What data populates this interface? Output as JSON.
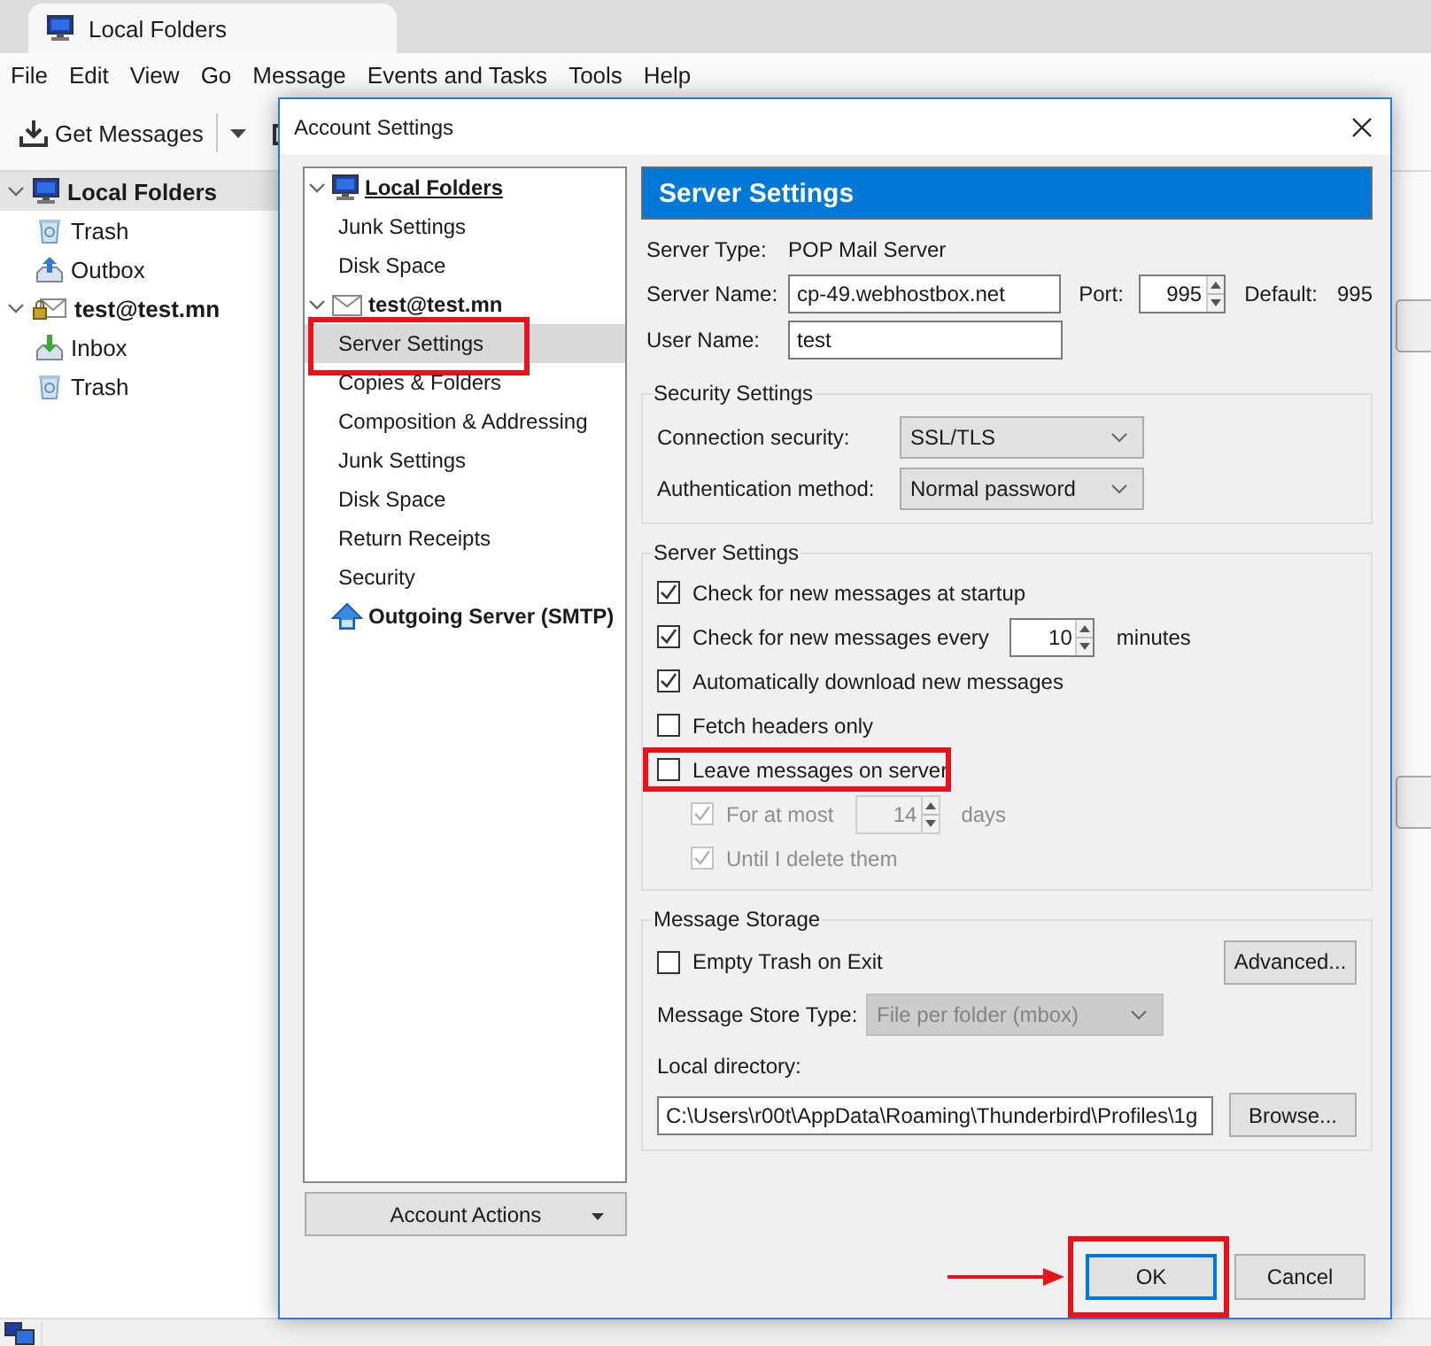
{
  "app_tab": {
    "title": "Local Folders"
  },
  "menu": [
    "File",
    "Edit",
    "View",
    "Go",
    "Message",
    "Events and Tasks",
    "Tools",
    "Help"
  ],
  "toolbar": {
    "get_messages": "Get Messages"
  },
  "folders": [
    {
      "label": "Local Folders",
      "kind": "computer",
      "expanded": true,
      "selected": true,
      "children": [
        {
          "label": "Trash",
          "kind": "trash",
          "selected": false
        },
        {
          "label": "Outbox",
          "kind": "outbox",
          "selected": false
        }
      ]
    },
    {
      "label": "test@test.mn",
      "kind": "account",
      "expanded": true,
      "selected": false,
      "children": [
        {
          "label": "Inbox",
          "kind": "inbox",
          "selected": false
        },
        {
          "label": "Trash",
          "kind": "trash",
          "selected": false
        }
      ]
    }
  ],
  "dialog": {
    "title": "Account Settings",
    "tree": [
      {
        "label": "Local Folders",
        "kind": "computer",
        "expanded": true,
        "selected": false,
        "children": [
          {
            "label": "Junk Settings",
            "selected": false,
            "highlighted": false
          },
          {
            "label": "Disk Space",
            "selected": false,
            "highlighted": false
          }
        ]
      },
      {
        "label": "test@test.mn",
        "kind": "account",
        "expanded": true,
        "selected": false,
        "children": [
          {
            "label": "Server Settings",
            "selected": true,
            "highlighted": true
          },
          {
            "label": "Copies & Folders",
            "selected": false,
            "highlighted": false
          },
          {
            "label": "Composition & Addressing",
            "selected": false,
            "highlighted": false
          },
          {
            "label": "Junk Settings",
            "selected": false,
            "highlighted": false
          },
          {
            "label": "Disk Space",
            "selected": false,
            "highlighted": false
          },
          {
            "label": "Return Receipts",
            "selected": false,
            "highlighted": false
          },
          {
            "label": "Security",
            "selected": false,
            "highlighted": false
          }
        ]
      },
      {
        "label": "Outgoing Server (SMTP)",
        "kind": "smtp",
        "selected": false
      }
    ],
    "account_actions": "Account Actions",
    "page_title": "Server Settings",
    "server_type": {
      "label": "Server Type:",
      "value": "POP Mail Server"
    },
    "server_name": {
      "label": "Server Name:",
      "value": "cp-49.webhostbox.net"
    },
    "port": {
      "label": "Port:",
      "value": "995"
    },
    "default": {
      "label": "Default:",
      "value": "995"
    },
    "user_name": {
      "label": "User Name:",
      "value": "test"
    },
    "security": {
      "title": "Security Settings",
      "fields": [
        {
          "label": "Connection security:",
          "value": "SSL/TLS",
          "disabled": false
        },
        {
          "label": "Authentication method:",
          "value": "Normal password",
          "disabled": false
        }
      ]
    },
    "server_settings": {
      "title": "Server Settings",
      "options": [
        {
          "label": "Check for new messages at startup",
          "checked": true,
          "disabled": false,
          "highlighted": false
        },
        {
          "label": "Check for new messages every",
          "checked": true,
          "disabled": false,
          "highlighted": false,
          "number": "10",
          "suffix": "minutes"
        },
        {
          "label": "Automatically download new messages",
          "checked": true,
          "disabled": false,
          "highlighted": false
        },
        {
          "label": "Fetch headers only",
          "checked": false,
          "disabled": false,
          "highlighted": false
        },
        {
          "label": "Leave messages on server",
          "checked": false,
          "disabled": false,
          "highlighted": true,
          "children": [
            {
              "label": "For at most",
              "checked": true,
              "disabled": true,
              "highlighted": false,
              "number": "14",
              "suffix": "days"
            },
            {
              "label": "Until I delete them",
              "checked": true,
              "disabled": true,
              "highlighted": false
            }
          ]
        }
      ]
    },
    "storage": {
      "title": "Message Storage",
      "empty_trash": {
        "label": "Empty Trash on Exit",
        "checked": false
      },
      "advanced": "Advanced...",
      "store_type": {
        "label": "Message Store Type:",
        "value": "File per folder (mbox)",
        "disabled": true
      },
      "local_dir": {
        "label": "Local directory:",
        "value": "C:\\Users\\r00t\\AppData\\Roaming\\Thunderbird\\Profiles\\1g"
      },
      "browse": "Browse..."
    },
    "buttons": [
      {
        "label": "OK",
        "default": true,
        "highlighted": true,
        "arrow": true
      },
      {
        "label": "Cancel",
        "default": false,
        "highlighted": false,
        "arrow": false
      }
    ]
  }
}
